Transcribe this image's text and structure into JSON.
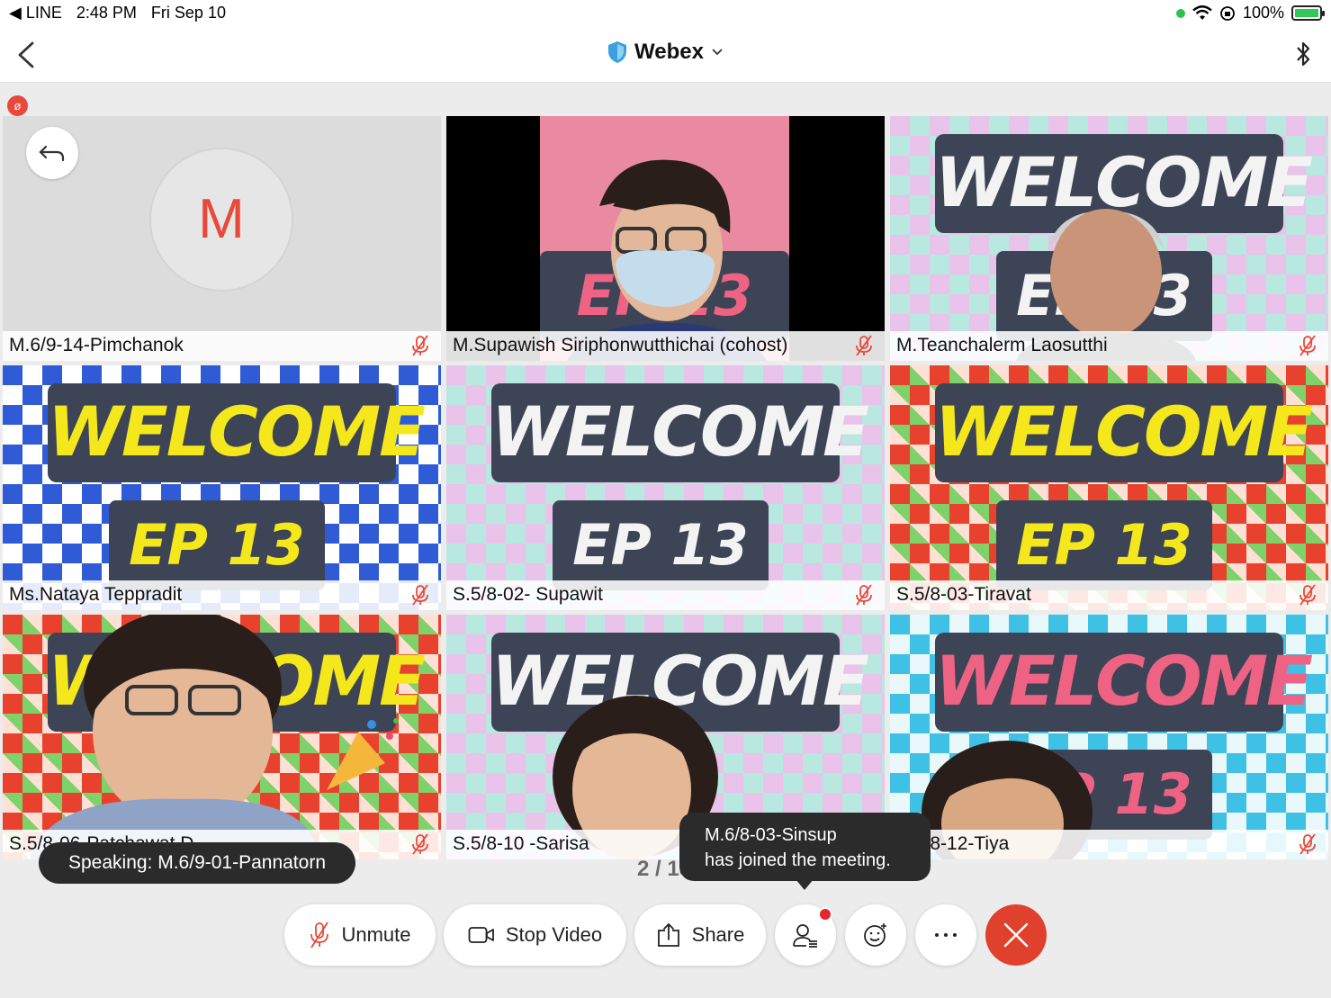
{
  "status_bar": {
    "back_app": "◀ LINE",
    "time": "2:48 PM",
    "date": "Fri Sep 10",
    "battery": "100%"
  },
  "header": {
    "title": "Webex"
  },
  "tiles": [
    {
      "name": "M.6/9-14-Pimchanok",
      "avatar_letter": "M"
    },
    {
      "name": "M.Supawish Siriphonwutthichai (cohost)"
    },
    {
      "name": "M.Teanchalerm Laosutthi"
    },
    {
      "name": "Ms.Nataya Teppradit"
    },
    {
      "name": "S.5/8-02- Supawit"
    },
    {
      "name": "S.5/8-03-Tiravat"
    },
    {
      "name": "S.5/8-06-Patchawat D."
    },
    {
      "name": "S.5/8-10 -Sarisa"
    },
    {
      "name": "S.5/8-12-Tiya"
    }
  ],
  "backgrounds": {
    "welcome": "WELCOME",
    "ep": "EP 13"
  },
  "speaking": "Speaking: M.6/9-01-Pannatorn",
  "page_indicator": "2 / 13",
  "toast": {
    "line1": "M.6/8-03-Sinsup",
    "line2": "has joined the meeting."
  },
  "controls": {
    "unmute": "Unmute",
    "stop_video": "Stop Video",
    "share": "Share"
  },
  "colors": {
    "accent_red": "#e0412d",
    "mute_red": "#e8493a"
  }
}
